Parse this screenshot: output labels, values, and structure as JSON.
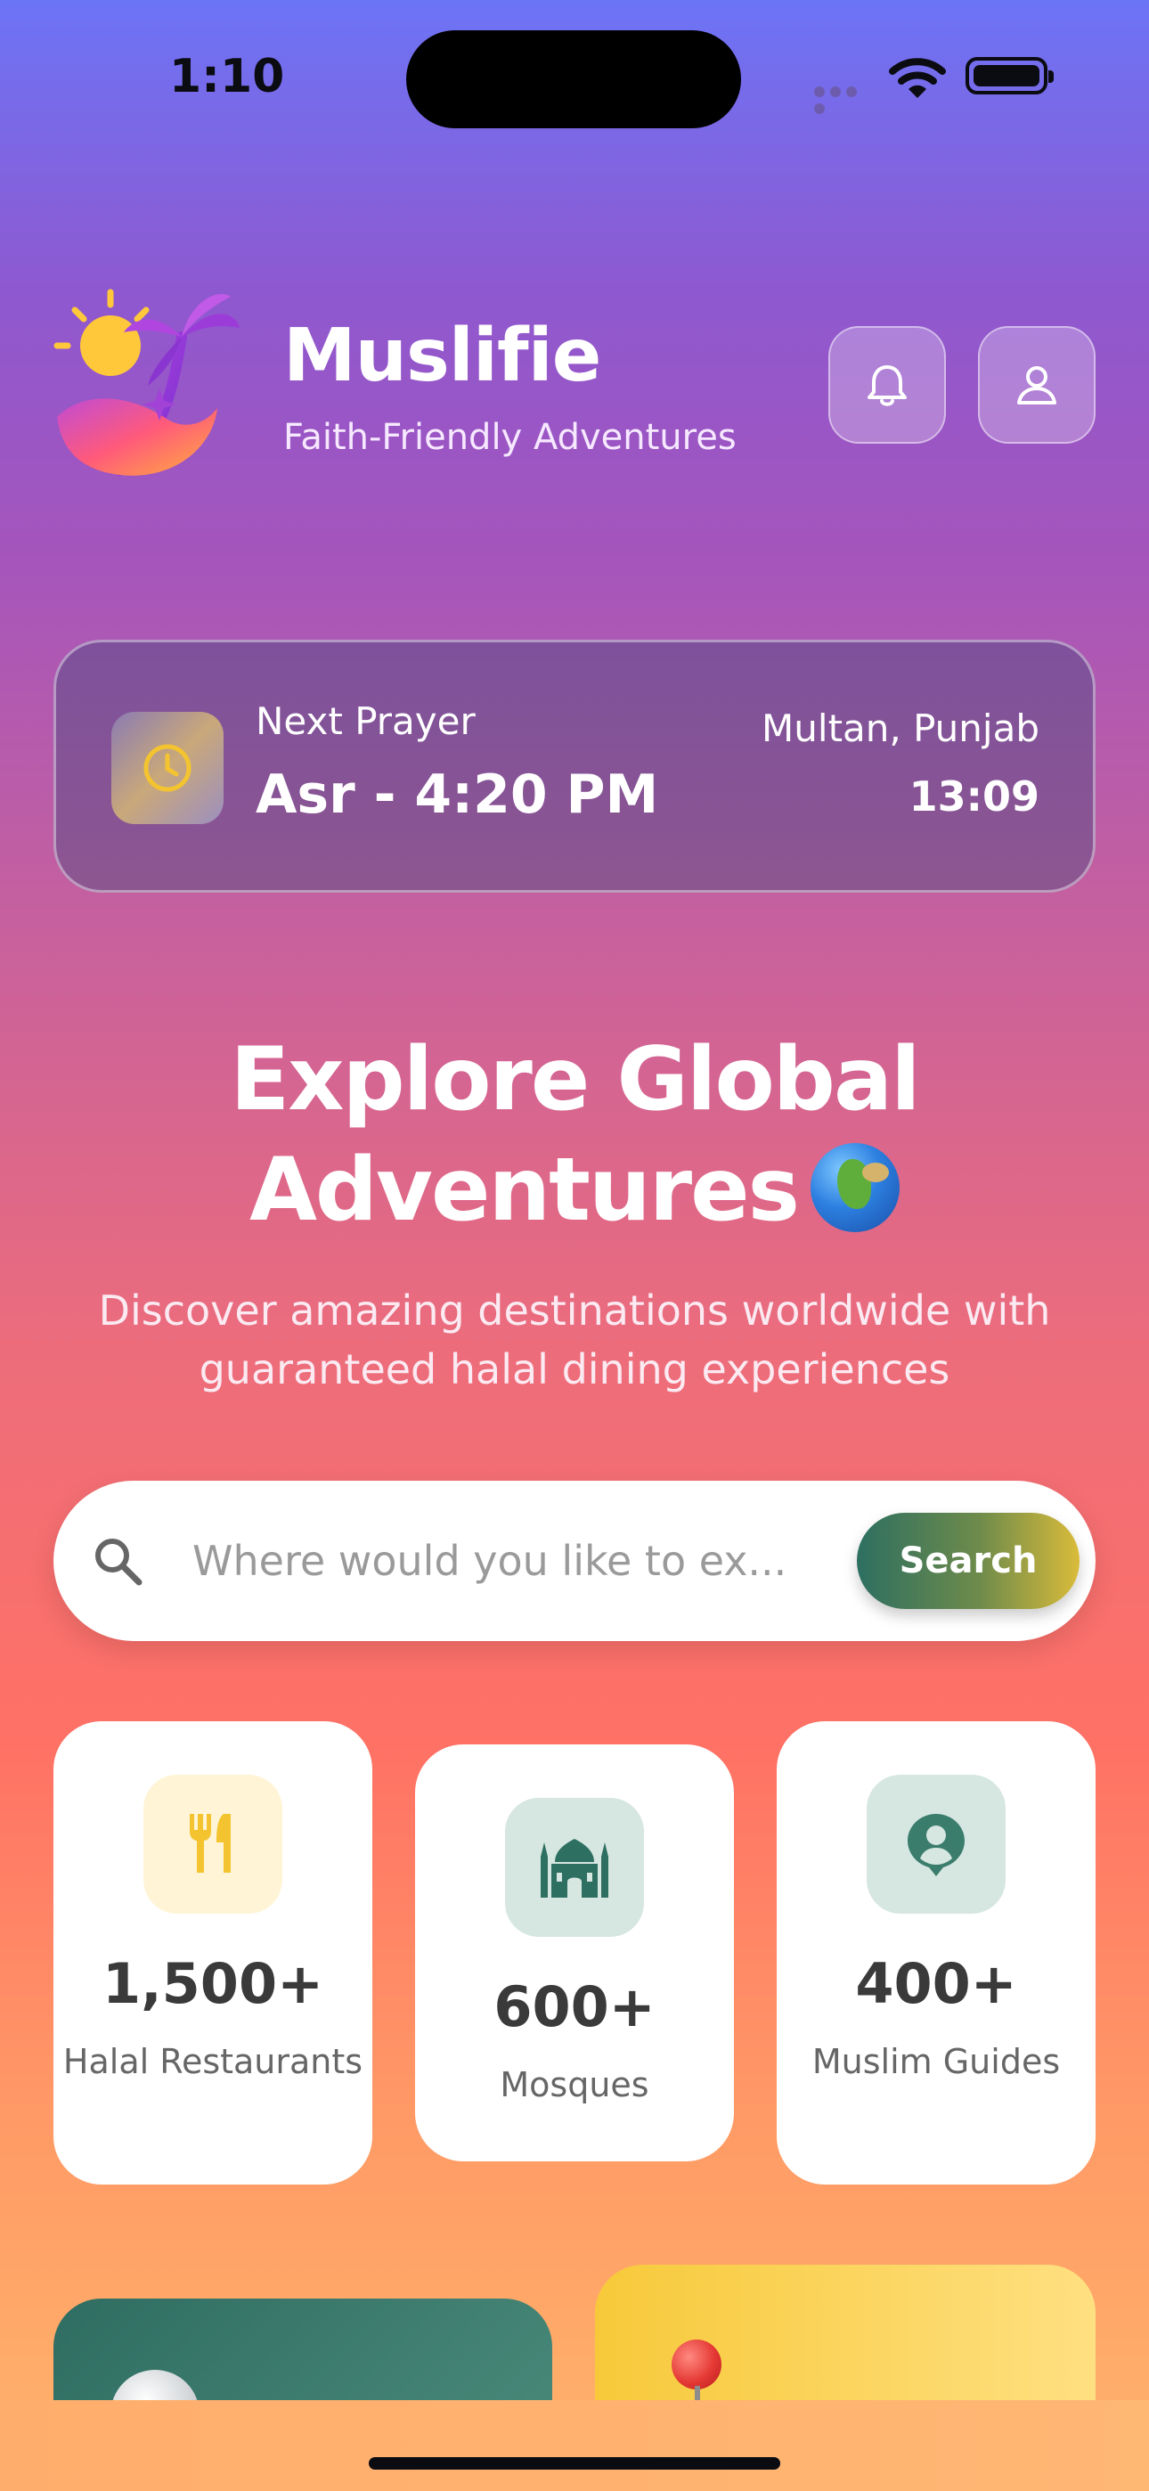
{
  "status_bar": {
    "time": "1:10"
  },
  "header": {
    "app_name": "Muslifie",
    "tagline": "Faith-Friendly Adventures",
    "icons": {
      "logo": "sun-palm-wave-logo",
      "notifications": "bell-icon",
      "profile": "user-icon"
    }
  },
  "prayer_card": {
    "label": "Next Prayer",
    "prayer": "Asr - 4:20 PM",
    "location": "Multan, Punjab",
    "current_time": "13:09",
    "icon": "clock-icon"
  },
  "hero": {
    "title_line1": "Explore Global",
    "title_line2": "Adventures",
    "title_emoji": "globe-icon",
    "description": "Discover amazing destinations worldwide with guaranteed halal dining experiences"
  },
  "search": {
    "placeholder": "Where would you like to ex...",
    "button_label": "Search"
  },
  "stats": [
    {
      "value": "1,500+",
      "label": "Halal Restaurants",
      "icon": "fork-knife-icon",
      "accent": "#f4c430"
    },
    {
      "value": "600+",
      "label": "Mosques",
      "icon": "mosque-icon",
      "accent": "#2d6f61"
    },
    {
      "value": "400+",
      "label": "Muslim Guides",
      "icon": "guide-icon",
      "accent": "#3b7d6c"
    }
  ],
  "colors": {
    "brand_green": "#2d6f61",
    "brand_yellow": "#f7c93a",
    "gradient_top": "#6c74f6",
    "gradient_bottom": "#ffb46b"
  }
}
